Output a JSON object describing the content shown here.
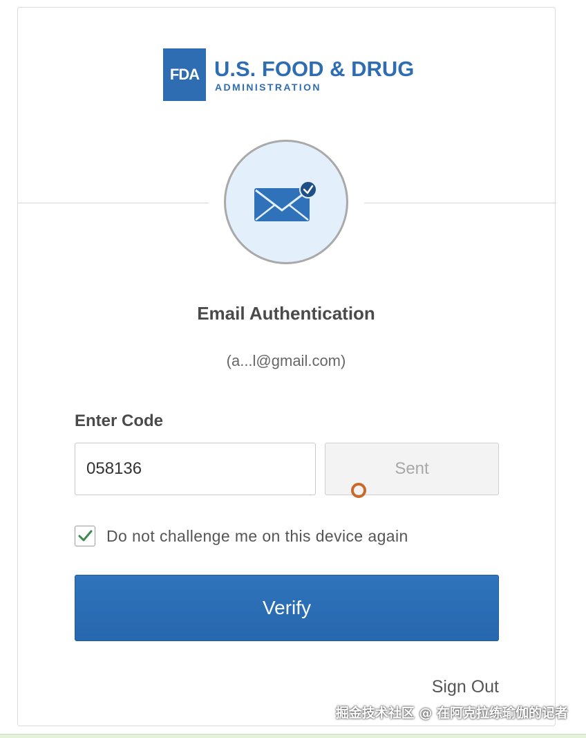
{
  "logo": {
    "mark": "FDA",
    "title": "U.S. FOOD & DRUG",
    "subtitle": "ADMINISTRATION",
    "color": "#2f6db3"
  },
  "badge": {
    "icon": "envelope-check-icon",
    "background": "#e3f0fb"
  },
  "auth": {
    "heading": "Email Authentication",
    "email": "(a...l@gmail.com)"
  },
  "code": {
    "label": "Enter Code",
    "value": "058136",
    "send_button_label": "Sent"
  },
  "remember": {
    "checked": true,
    "label": "Do not challenge me on this device again"
  },
  "verify": {
    "label": "Verify",
    "color": "#2f74bc"
  },
  "footer": {
    "sign_out_label": "Sign Out"
  },
  "watermark": "掘金技术社区 @ 在阿克拉练瑜伽的记者"
}
